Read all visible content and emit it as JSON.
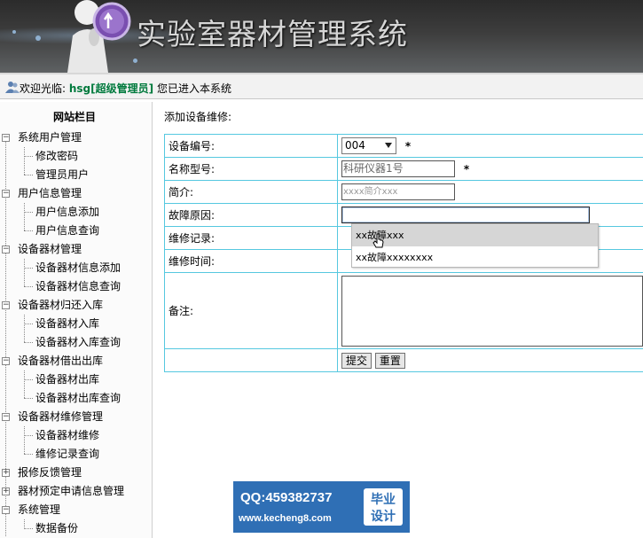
{
  "header": {
    "title": "实验室器材管理系统"
  },
  "welcome": {
    "greeting": "欢迎光临:",
    "username": "hsg",
    "role": "[超级管理员]",
    "suffix": "您已进入本系统"
  },
  "sidebar": {
    "heading": "网站栏目",
    "groups": [
      {
        "label": "系统用户管理",
        "items": [
          "修改密码",
          "管理员用户"
        ]
      },
      {
        "label": "用户信息管理",
        "items": [
          "用户信息添加",
          "用户信息查询"
        ]
      },
      {
        "label": "设备器材管理",
        "items": [
          "设备器材信息添加",
          "设备器材信息查询"
        ]
      },
      {
        "label": "设备器材归还入库",
        "items": [
          "设备器材入库",
          "设备器材入库查询"
        ]
      },
      {
        "label": "设备器材借出出库",
        "items": [
          "设备器材出库",
          "设备器材出库查询"
        ]
      },
      {
        "label": "设备器材维修管理",
        "items": [
          "设备器材维修",
          "维修记录查询"
        ]
      },
      {
        "label": "报修反馈管理",
        "items": []
      },
      {
        "label": "器材预定申请信息管理",
        "items": []
      },
      {
        "label": "系统管理",
        "items": [
          "数据备份"
        ]
      }
    ]
  },
  "form": {
    "caption": "添加设备维修:",
    "fields": {
      "device_no": {
        "label": "设备编号:",
        "value": "004",
        "required": "*"
      },
      "model": {
        "label": "名称型号:",
        "value": "科研仪器1号",
        "required": "*"
      },
      "intro": {
        "label": "简介:",
        "value": "xxxx简介xxx"
      },
      "fault": {
        "label": "故障原因:",
        "value": ""
      },
      "record": {
        "label": "维修记录:"
      },
      "time": {
        "label": "维修时间:"
      },
      "remark": {
        "label": "备注:"
      }
    },
    "buttons": {
      "submit": "提交",
      "reset": "重置"
    }
  },
  "autocomplete": {
    "options": [
      "xx故障xxx",
      "xx故障xxxxxxxx"
    ],
    "hovered_index": 0
  },
  "watermark": {
    "qq": "QQ:459382737",
    "url": "www.kecheng8.com",
    "badge_line1": "毕业",
    "badge_line2": "设计"
  },
  "colors": {
    "header_bg": "#3d3d3d",
    "table_border": "#56c8e0",
    "username_green": "#007a3d",
    "watermark_blue": "#2f6fb5"
  }
}
